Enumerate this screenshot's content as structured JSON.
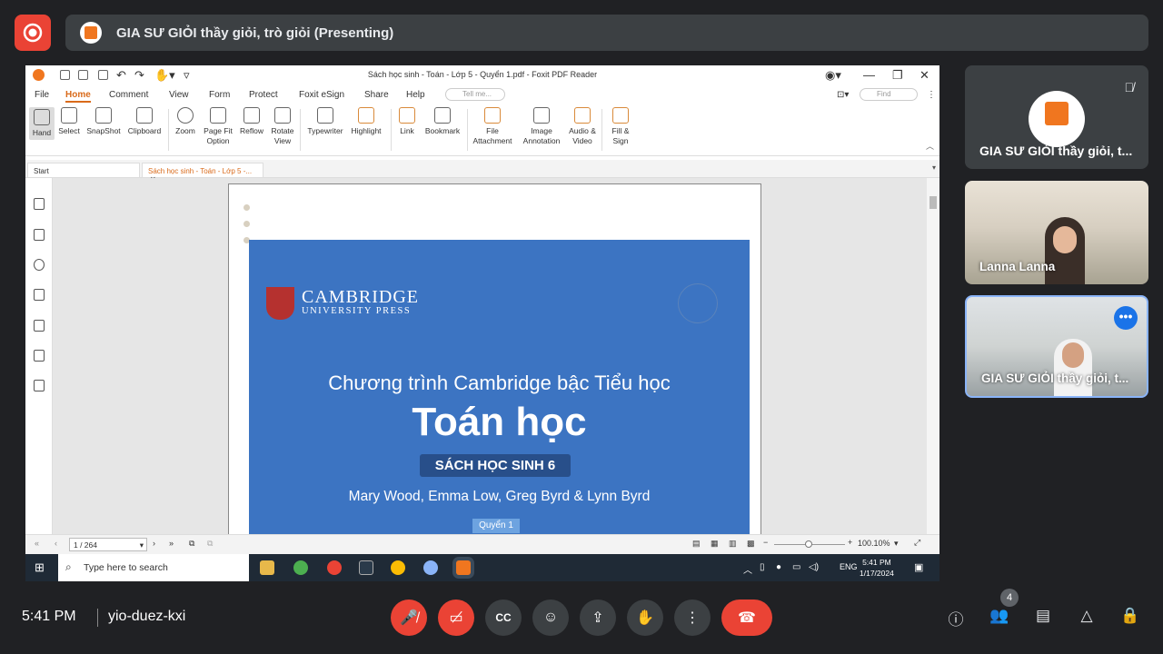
{
  "presenting": {
    "title": "GIA SƯ GIỎI thầy giỏi, trò giỏi (Presenting)"
  },
  "app": {
    "window_title": "Sách học sinh - Toán - Lớp 5 - Quyển 1.pdf - Foxit PDF Reader",
    "menu": [
      "File",
      "Home",
      "Comment",
      "View",
      "Form",
      "Protect",
      "Foxit eSign",
      "Share",
      "Help"
    ],
    "tell_me": "Tell me...",
    "find": "Find",
    "ribbon": [
      {
        "label": "Hand"
      },
      {
        "label": "Select"
      },
      {
        "label": "SnapShot"
      },
      {
        "label": "Clipboard"
      },
      {
        "label": "Zoom"
      },
      {
        "label": "Page Fit Option"
      },
      {
        "label": "Reflow"
      },
      {
        "label": "Rotate View"
      },
      {
        "label": "Typewriter"
      },
      {
        "label": "Highlight"
      },
      {
        "label": "Link"
      },
      {
        "label": "Bookmark"
      },
      {
        "label": "File Attachment"
      },
      {
        "label": "Image Annotation"
      },
      {
        "label": "Audio & Video"
      },
      {
        "label": "Fill & Sign"
      }
    ],
    "tabs": {
      "start": "Start",
      "doc": "Sách học sinh - Toán - Lớp 5 -..."
    },
    "page_indicator": "1 / 264",
    "zoom": "100.10%"
  },
  "cover": {
    "publisher": "CAMBRIDGE",
    "publisher_sub": "UNIVERSITY PRESS",
    "program": "Chương trình Cambridge bậc Tiểu học",
    "title": "Toán học",
    "badge": "SÁCH HỌC SINH 6",
    "authors": "Mary Wood, Emma Low, Greg Byrd & Lynn Byrd",
    "volume": "Quyển 1"
  },
  "taskbar": {
    "search": "Type here to search",
    "lang": "ENG",
    "time": "5:41 PM",
    "date": "1/17/2024"
  },
  "participants": [
    {
      "name": "GIA SƯ GIỎI thầy giỏi, t...",
      "muted": true
    },
    {
      "name": "Lanna Lanna"
    },
    {
      "name": "GIA SƯ GIỎI thầy giỏi, t..."
    }
  ],
  "meeting": {
    "time": "5:41 PM",
    "code": "yio-duez-kxi",
    "people_count": "4"
  },
  "colors": {
    "end_call": "#ea4335",
    "accent": "#d96a1a",
    "cover_blue": "#3c74c2"
  }
}
